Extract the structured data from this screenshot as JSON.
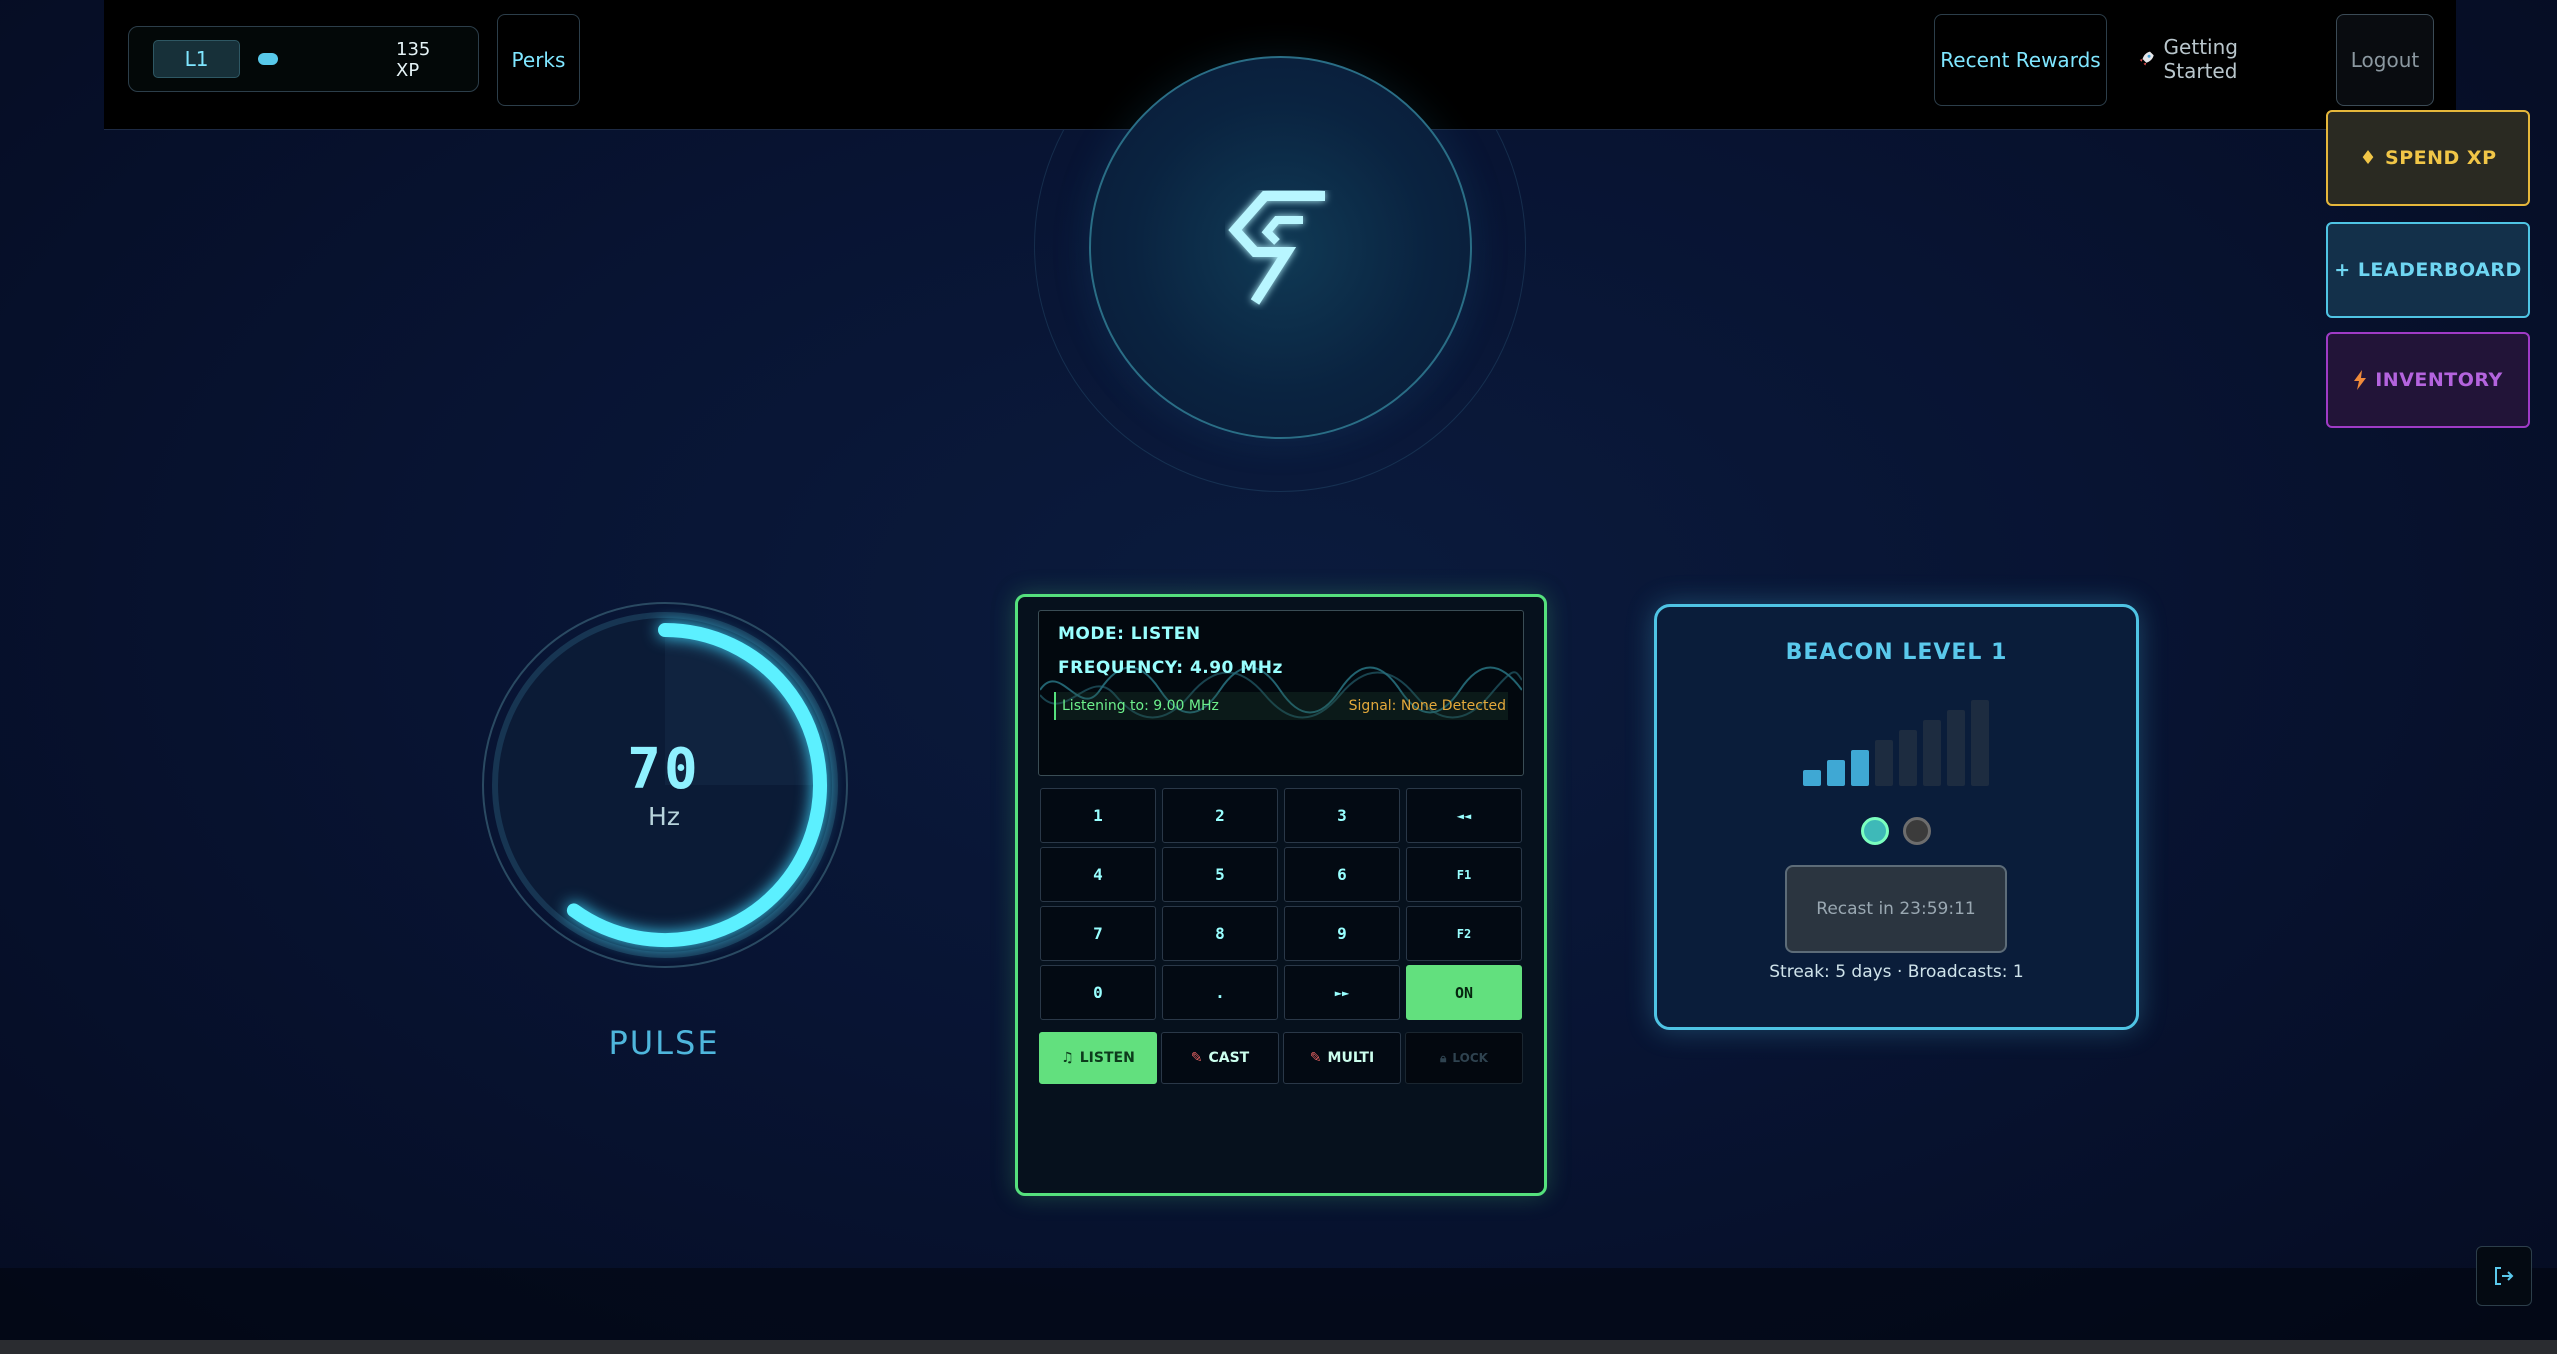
{
  "topbar": {
    "level": "L1",
    "xp": "135 XP",
    "perks_label": "Perks",
    "recent_rewards_label": "Recent Rewards",
    "getting_started_label": "Getting Started",
    "logout_label": "Logout"
  },
  "side_buttons": {
    "spend_xp": "SPEND XP",
    "leaderboard": "+ LEADERBOARD",
    "inventory": "INVENTORY"
  },
  "pulse": {
    "value": "70",
    "unit": "Hz",
    "label": "PULSE",
    "fill_fraction": 0.6
  },
  "radio": {
    "mode": "MODE: LISTEN",
    "frequency": "FREQUENCY: 4.90 MHz",
    "listening": "Listening to: 9.00 MHz",
    "signal": "Signal: None Detected",
    "keys": [
      [
        "1",
        "2",
        "3",
        "◄◄"
      ],
      [
        "4",
        "5",
        "6",
        "F1"
      ],
      [
        "7",
        "8",
        "9",
        "F2"
      ],
      [
        "0",
        ".",
        "►►",
        "ON"
      ]
    ],
    "modes": {
      "listen": "LISTEN",
      "cast": "CAST",
      "multi": "MULTI",
      "lock": "LOCK"
    }
  },
  "beacon": {
    "title": "BEACON LEVEL 1",
    "signal_bars_active": 3,
    "signal_bars_total": 8,
    "recast": "Recast in 23:59:11",
    "streak": "Streak: 5 days · Broadcasts: 1"
  },
  "colors": {
    "accent_cyan": "#5ac9ec",
    "accent_green": "#62e07e",
    "gold": "#f1c647",
    "purple": "#b464de"
  }
}
